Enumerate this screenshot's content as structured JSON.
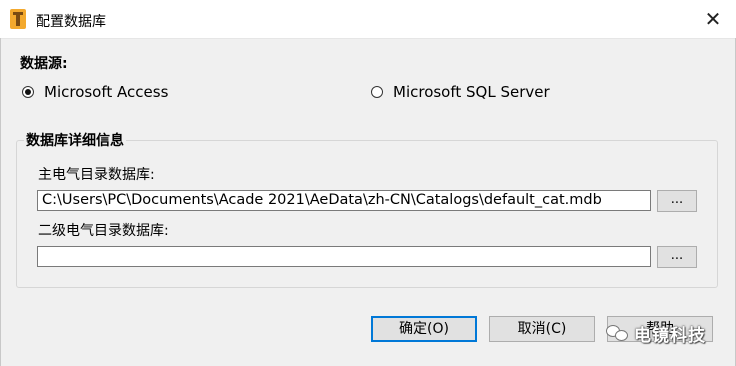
{
  "window": {
    "title": "配置数据库",
    "close_glyph": "✕"
  },
  "data_source": {
    "label": "数据源:",
    "options": [
      {
        "label": "Microsoft Access",
        "selected": true
      },
      {
        "label": "Microsoft SQL Server",
        "selected": false
      }
    ]
  },
  "details": {
    "group_title": "数据库详细信息",
    "main_db": {
      "label": "主电气目录数据库:",
      "value": "C:\\Users\\PC\\Documents\\Acade 2021\\AeData\\zh-CN\\Catalogs\\default_cat.mdb",
      "browse_label": "..."
    },
    "secondary_db": {
      "label": "二级电气目录数据库:",
      "value": "",
      "browse_label": "..."
    }
  },
  "buttons": {
    "ok": "确定(O)",
    "cancel": "取消(C)",
    "help": "帮助"
  },
  "watermark": {
    "text": "电镜科技"
  },
  "colors": {
    "focus_border": "#0078d7",
    "dialog_bg": "#f0f0f0"
  }
}
